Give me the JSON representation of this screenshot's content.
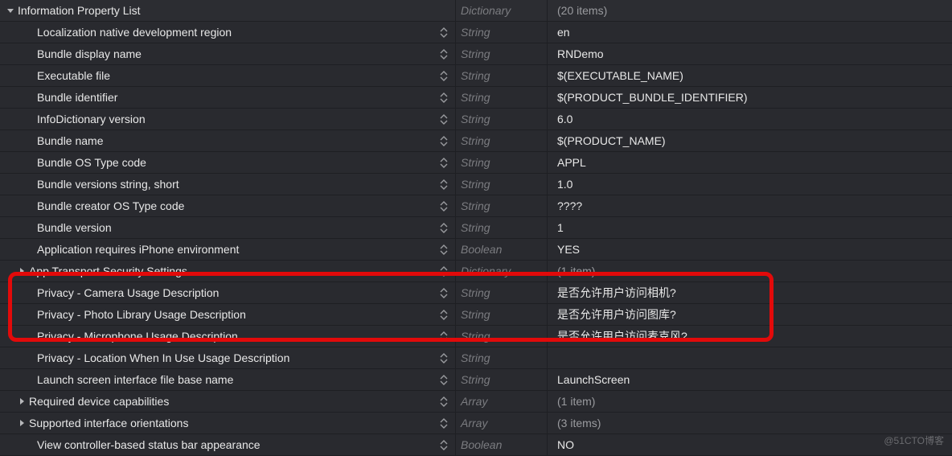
{
  "root": {
    "key": "Information Property List",
    "type": "Dictionary",
    "value": "(20 items)"
  },
  "rows": [
    {
      "key": "Localization native development region",
      "type": "String",
      "value": "en",
      "indent": 2,
      "stepper": true,
      "disclosure": "",
      "muted": false
    },
    {
      "key": "Bundle display name",
      "type": "String",
      "value": "RNDemo",
      "indent": 2,
      "stepper": true,
      "disclosure": "",
      "muted": false
    },
    {
      "key": "Executable file",
      "type": "String",
      "value": "$(EXECUTABLE_NAME)",
      "indent": 2,
      "stepper": true,
      "disclosure": "",
      "muted": false
    },
    {
      "key": "Bundle identifier",
      "type": "String",
      "value": "$(PRODUCT_BUNDLE_IDENTIFIER)",
      "indent": 2,
      "stepper": true,
      "disclosure": "",
      "muted": false
    },
    {
      "key": "InfoDictionary version",
      "type": "String",
      "value": "6.0",
      "indent": 2,
      "stepper": true,
      "disclosure": "",
      "muted": false
    },
    {
      "key": "Bundle name",
      "type": "String",
      "value": "$(PRODUCT_NAME)",
      "indent": 2,
      "stepper": true,
      "disclosure": "",
      "muted": false
    },
    {
      "key": "Bundle OS Type code",
      "type": "String",
      "value": "APPL",
      "indent": 2,
      "stepper": true,
      "disclosure": "",
      "muted": false
    },
    {
      "key": "Bundle versions string, short",
      "type": "String",
      "value": "1.0",
      "indent": 2,
      "stepper": true,
      "disclosure": "",
      "muted": false
    },
    {
      "key": "Bundle creator OS Type code",
      "type": "String",
      "value": "????",
      "indent": 2,
      "stepper": true,
      "disclosure": "",
      "muted": false
    },
    {
      "key": "Bundle version",
      "type": "String",
      "value": "1",
      "indent": 2,
      "stepper": true,
      "disclosure": "",
      "muted": false
    },
    {
      "key": "Application requires iPhone environment",
      "type": "Boolean",
      "value": "YES",
      "indent": 2,
      "stepper": true,
      "disclosure": "",
      "muted": false
    },
    {
      "key": "App Transport Security Settings",
      "type": "Dictionary",
      "value": "(1 item)",
      "indent": 1,
      "stepper": true,
      "disclosure": "right",
      "muted": true
    },
    {
      "key": "Privacy - Camera Usage Description",
      "type": "String",
      "value": "是否允许用户访问相机?",
      "indent": 2,
      "stepper": true,
      "disclosure": "",
      "muted": false
    },
    {
      "key": "Privacy - Photo Library Usage Description",
      "type": "String",
      "value": "是否允许用户访问图库?",
      "indent": 2,
      "stepper": true,
      "disclosure": "",
      "muted": false
    },
    {
      "key": "Privacy - Microphone Usage Description",
      "type": "String",
      "value": "是否允许用户访问麦克风?",
      "indent": 2,
      "stepper": true,
      "disclosure": "",
      "muted": false
    },
    {
      "key": "Privacy - Location When In Use Usage Description",
      "type": "String",
      "value": "",
      "indent": 2,
      "stepper": true,
      "disclosure": "",
      "muted": false
    },
    {
      "key": "Launch screen interface file base name",
      "type": "String",
      "value": "LaunchScreen",
      "indent": 2,
      "stepper": true,
      "disclosure": "",
      "muted": false
    },
    {
      "key": "Required device capabilities",
      "type": "Array",
      "value": "(1 item)",
      "indent": 1,
      "stepper": true,
      "disclosure": "right",
      "muted": true
    },
    {
      "key": "Supported interface orientations",
      "type": "Array",
      "value": "(3 items)",
      "indent": 1,
      "stepper": true,
      "disclosure": "right",
      "muted": true
    },
    {
      "key": "View controller-based status bar appearance",
      "type": "Boolean",
      "value": "NO",
      "indent": 2,
      "stepper": true,
      "disclosure": "",
      "muted": false
    }
  ],
  "watermark": "@51CTO博客"
}
